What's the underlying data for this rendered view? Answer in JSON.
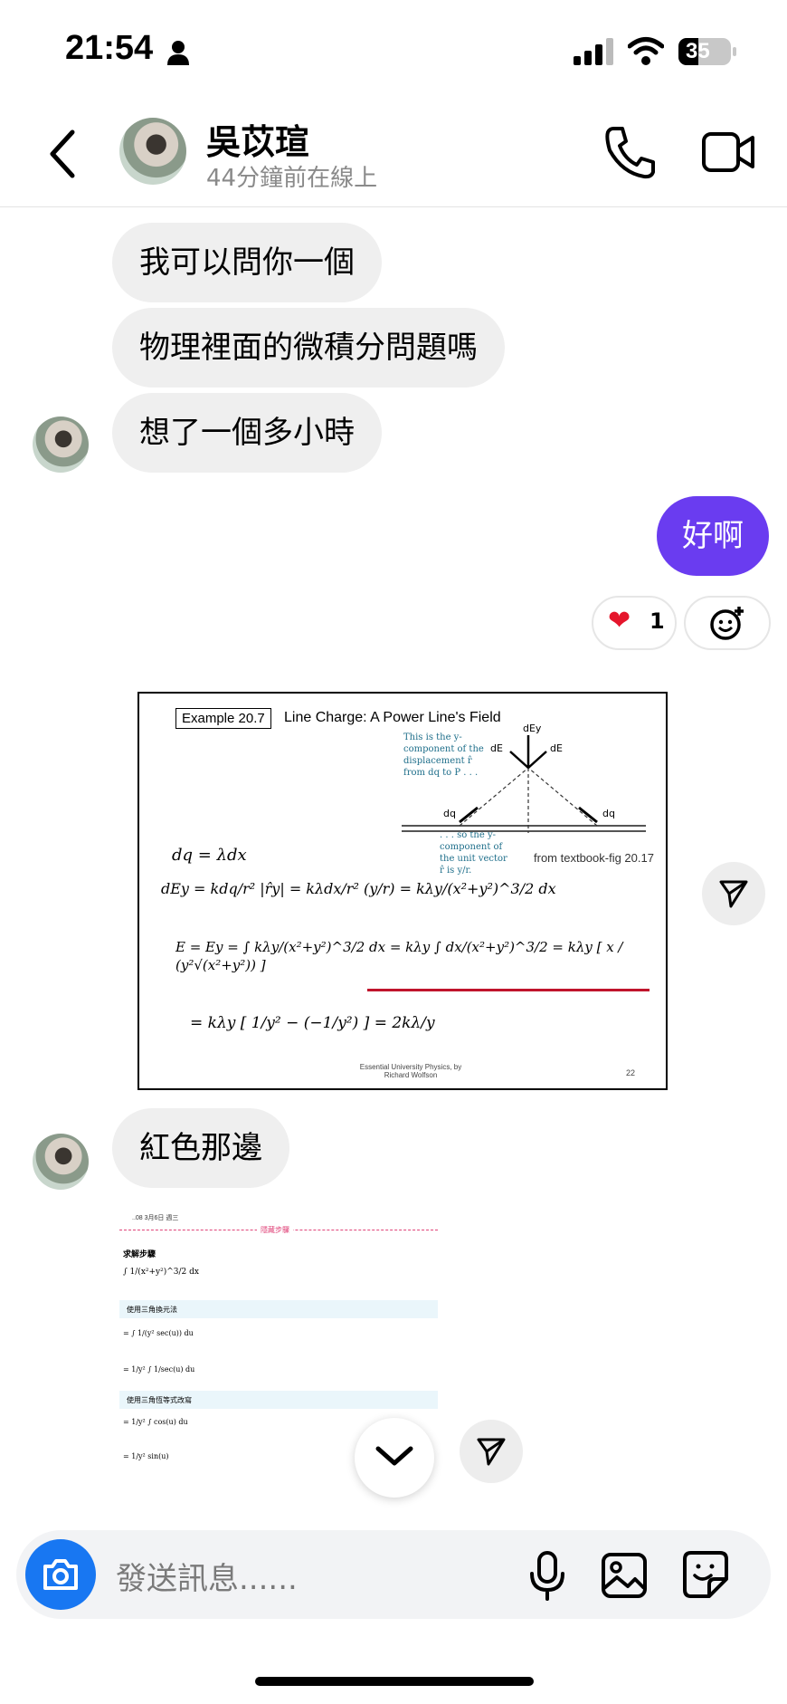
{
  "status_bar": {
    "time": "21:54",
    "battery": "35"
  },
  "header": {
    "name": "吳苡瑄",
    "status": "44分鐘前在線上"
  },
  "messages": {
    "m1": "我可以問你一個",
    "m2": "物理裡面的微積分問題嗎",
    "m3": "想了一個多小時",
    "mine1": "好啊",
    "reaction_count": "1",
    "m4": "紅色那邊"
  },
  "slide": {
    "example": "Example 20.7",
    "title": "Line Charge: A Power Line's Field",
    "note1": "This is the y-component of the displacement r̂ from dq to P . . .",
    "note2": ". . . so the y-component of the unit vector r̂ is y/r.",
    "caption": "from textbook-fig 20.17",
    "eq1": "dq = λdx",
    "eq2": "dEy = kdq/r² |r̂y| = kλdx/r² (y/r) = kλy/(x²+y²)^3/2 dx",
    "eq3": "E = Ey = ∫ kλy/(x²+y²)^3/2 dx = kλy ∫ dx/(x²+y²)^3/2 = kλy [ x / (y²√(x²+y²)) ]",
    "eq4": "= kλy [ 1/y² − (−1/y²) ] = 2kλ/y",
    "footer": "Essential University Physics, by Richard Wolfson",
    "page": "22"
  },
  "screenshot2": {
    "top_time": "..08  3月6日 週三",
    "hide_steps": "隱藏步驟",
    "solve_steps": "求解步驟",
    "trig_sub": "使用三角換元法",
    "trig_id": "使用三角恆等式改寫"
  },
  "composer": {
    "placeholder": "發送訊息......"
  },
  "colors": {
    "accent": "#6a3cf0",
    "camera": "#1877f2",
    "underline": "#c0142c"
  }
}
